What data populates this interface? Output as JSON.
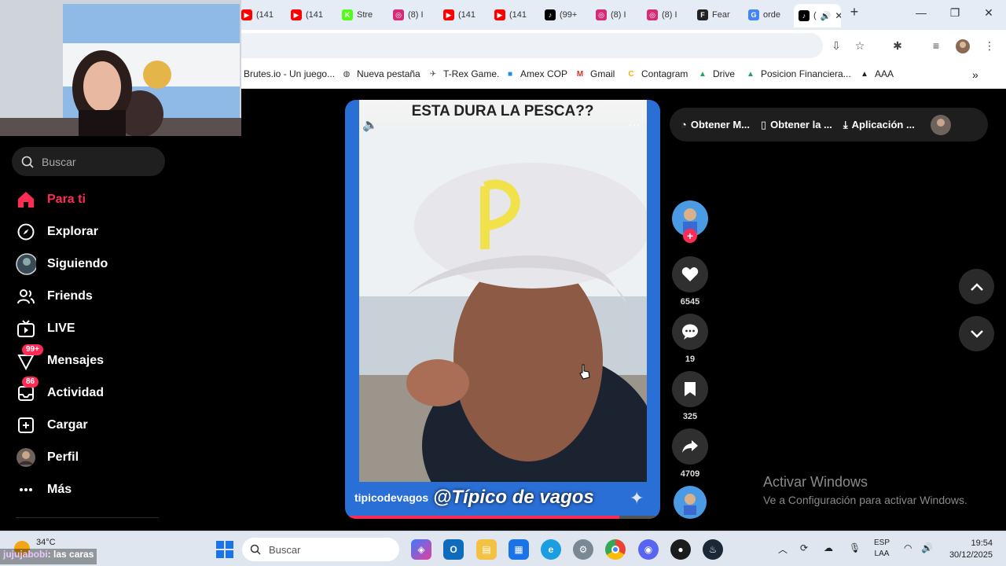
{
  "browser": {
    "tabs": [
      {
        "label": "(141",
        "icon": "youtube-icon",
        "color": "#ff0000"
      },
      {
        "label": "(141",
        "icon": "youtube-icon",
        "color": "#ff0000"
      },
      {
        "label": "Stre",
        "icon": "kick-icon",
        "color": "#53fc18"
      },
      {
        "label": "(8) I",
        "icon": "instagram-icon",
        "color": "#d62976"
      },
      {
        "label": "(141",
        "icon": "youtube-icon",
        "color": "#ff0000"
      },
      {
        "label": "(141",
        "icon": "youtube-icon",
        "color": "#ff0000"
      },
      {
        "label": "(99+",
        "icon": "tiktok-icon",
        "color": "#000000"
      },
      {
        "label": "(8) I",
        "icon": "instagram-icon",
        "color": "#d62976"
      },
      {
        "label": "(8) I",
        "icon": "instagram-icon",
        "color": "#d62976"
      },
      {
        "label": "Fear",
        "icon": "fear-icon",
        "color": "#222222"
      },
      {
        "label": "orde",
        "icon": "google-icon",
        "color": "#4285f4"
      },
      {
        "label": "(",
        "icon": "tiktok-icon",
        "color": "#000000"
      }
    ],
    "bookmarks": [
      {
        "label": "Brutes.io - Un juego...",
        "icon": ""
      },
      {
        "label": "Nueva pestaña",
        "icon": "globe-icon"
      },
      {
        "label": "T-Rex Game.",
        "icon": "dino-icon"
      },
      {
        "label": "Amex COP",
        "icon": "amex-icon"
      },
      {
        "label": "Gmail",
        "icon": "gmail-icon"
      },
      {
        "label": "Contagram",
        "icon": "contagram-icon"
      },
      {
        "label": "Drive",
        "icon": "drive-icon"
      },
      {
        "label": "Posicion Financiera...",
        "icon": "drive-icon"
      },
      {
        "label": "AAA",
        "icon": "aaa-icon"
      }
    ]
  },
  "sidebar": {
    "search_placeholder": "Buscar",
    "items": [
      {
        "label": "Para ti",
        "icon": "home-icon"
      },
      {
        "label": "Explorar",
        "icon": "compass-icon"
      },
      {
        "label": "Siguiendo",
        "icon": "following-avatar-icon"
      },
      {
        "label": "Friends",
        "icon": "friends-icon"
      },
      {
        "label": "LIVE",
        "icon": "live-tv-icon"
      },
      {
        "label": "Mensajes",
        "icon": "messages-icon",
        "badge": "99+"
      },
      {
        "label": "Actividad",
        "icon": "inbox-icon",
        "badge": "86"
      },
      {
        "label": "Cargar",
        "icon": "upload-plus-icon"
      },
      {
        "label": "Perfil",
        "icon": "profile-avatar-icon"
      },
      {
        "label": "Más",
        "icon": "more-dots-icon"
      }
    ],
    "accent": "#fe2c55"
  },
  "video": {
    "title": "ESTA DURA LA PESCA??",
    "author": "tipicodevagos",
    "watermark": "@Típico de vagos",
    "progress": 0.87
  },
  "actions": {
    "likes": "6545",
    "comments": "19",
    "saves": "325",
    "shares": "4709"
  },
  "top_pill": {
    "items": [
      "Obtener M...",
      "Obtener la ...",
      "Aplicación ..."
    ]
  },
  "windows_watermark": {
    "line1": "Activar Windows",
    "line2": "Ve a Configuración para activar Windows."
  },
  "taskbar": {
    "weather": "34°C",
    "search_placeholder": "Buscar",
    "lang_top": "ESP",
    "lang_bottom": "LAA",
    "time": "19:54",
    "date": "30/12/2025"
  },
  "chat": {
    "user": "jujujabobi",
    "message": ": las caras"
  }
}
